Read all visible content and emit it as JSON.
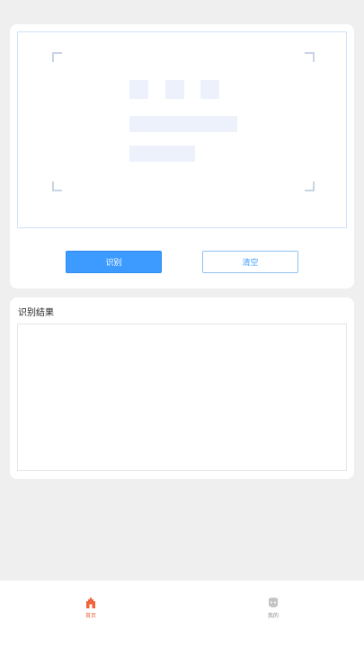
{
  "buttons": {
    "recognize_label": "识别",
    "clear_label": "清空"
  },
  "result": {
    "title": "识别结果",
    "text": ""
  },
  "tabbar": {
    "items": [
      {
        "label": "首页",
        "icon": "home-icon",
        "active": true
      },
      {
        "label": "我的",
        "icon": "profile-icon",
        "active": false
      }
    ]
  },
  "colors": {
    "primary": "#3d9bff",
    "active_tab": "#f0643c",
    "inactive_tab": "#8a8a8a",
    "background": "#efefef"
  }
}
